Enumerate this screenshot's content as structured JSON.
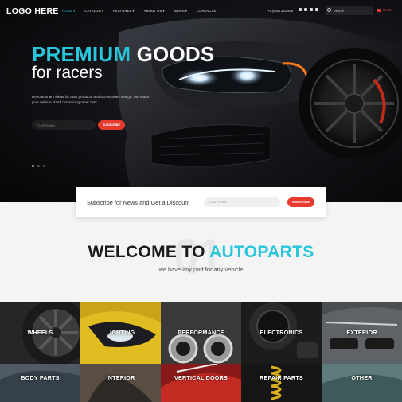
{
  "header": {
    "logo": "LOGO HERE",
    "menu": [
      {
        "label": "HOME",
        "active": true,
        "dropdown": true
      },
      {
        "label": "CATALOG",
        "active": false,
        "dropdown": true
      },
      {
        "label": "FEATURES",
        "active": false,
        "dropdown": true
      },
      {
        "label": "ABOUT US",
        "active": false,
        "dropdown": true
      },
      {
        "label": "NEWS",
        "active": false,
        "dropdown": true
      },
      {
        "label": "CONTACTS",
        "active": false,
        "dropdown": false
      }
    ],
    "phone": "+1 (800) 123 456",
    "search_placeholder": "Search",
    "cart_total": "$0.00",
    "social_icons": [
      "twitter-icon",
      "facebook-icon",
      "youtube-icon",
      "instagram-icon"
    ]
  },
  "hero": {
    "title_accent": "PREMIUM",
    "title_rest": " GOODS",
    "subtitle": "for racers",
    "description": "Revolutionary ideas for auto products and accessories design. We make your vehicle stand out among other cars.",
    "email_placeholder": "YOUR EMAIL",
    "subscribe_label": "SUBSCRIBE",
    "slides": 3,
    "active_slide": 1
  },
  "newsletter": {
    "text": "Subscribe for News and Get a Discount",
    "email_placeholder": "YOUR EMAIL",
    "subscribe_label": "SUBSCRIBE"
  },
  "welcome": {
    "number": "01",
    "title_prefix": "WELCOME TO ",
    "title_accent": "AUTOPARTS",
    "subtitle": "we have any part for any vehicle"
  },
  "categories": [
    {
      "label": "WHEELS"
    },
    {
      "label": "LIGHTING"
    },
    {
      "label": "PERFORMANCE"
    },
    {
      "label": "ELECTRONICS"
    },
    {
      "label": "EXTERIOR"
    },
    {
      "label": "BODY PARTS"
    },
    {
      "label": "INTERIOR"
    },
    {
      "label": "VERTICAL DOORS"
    },
    {
      "label": "REPAIR PARTS"
    },
    {
      "label": "OTHER"
    }
  ],
  "colors": {
    "accent": "#28c6db",
    "brand_red": "#e63b2e",
    "dark_bg": "#0c0c0e"
  }
}
